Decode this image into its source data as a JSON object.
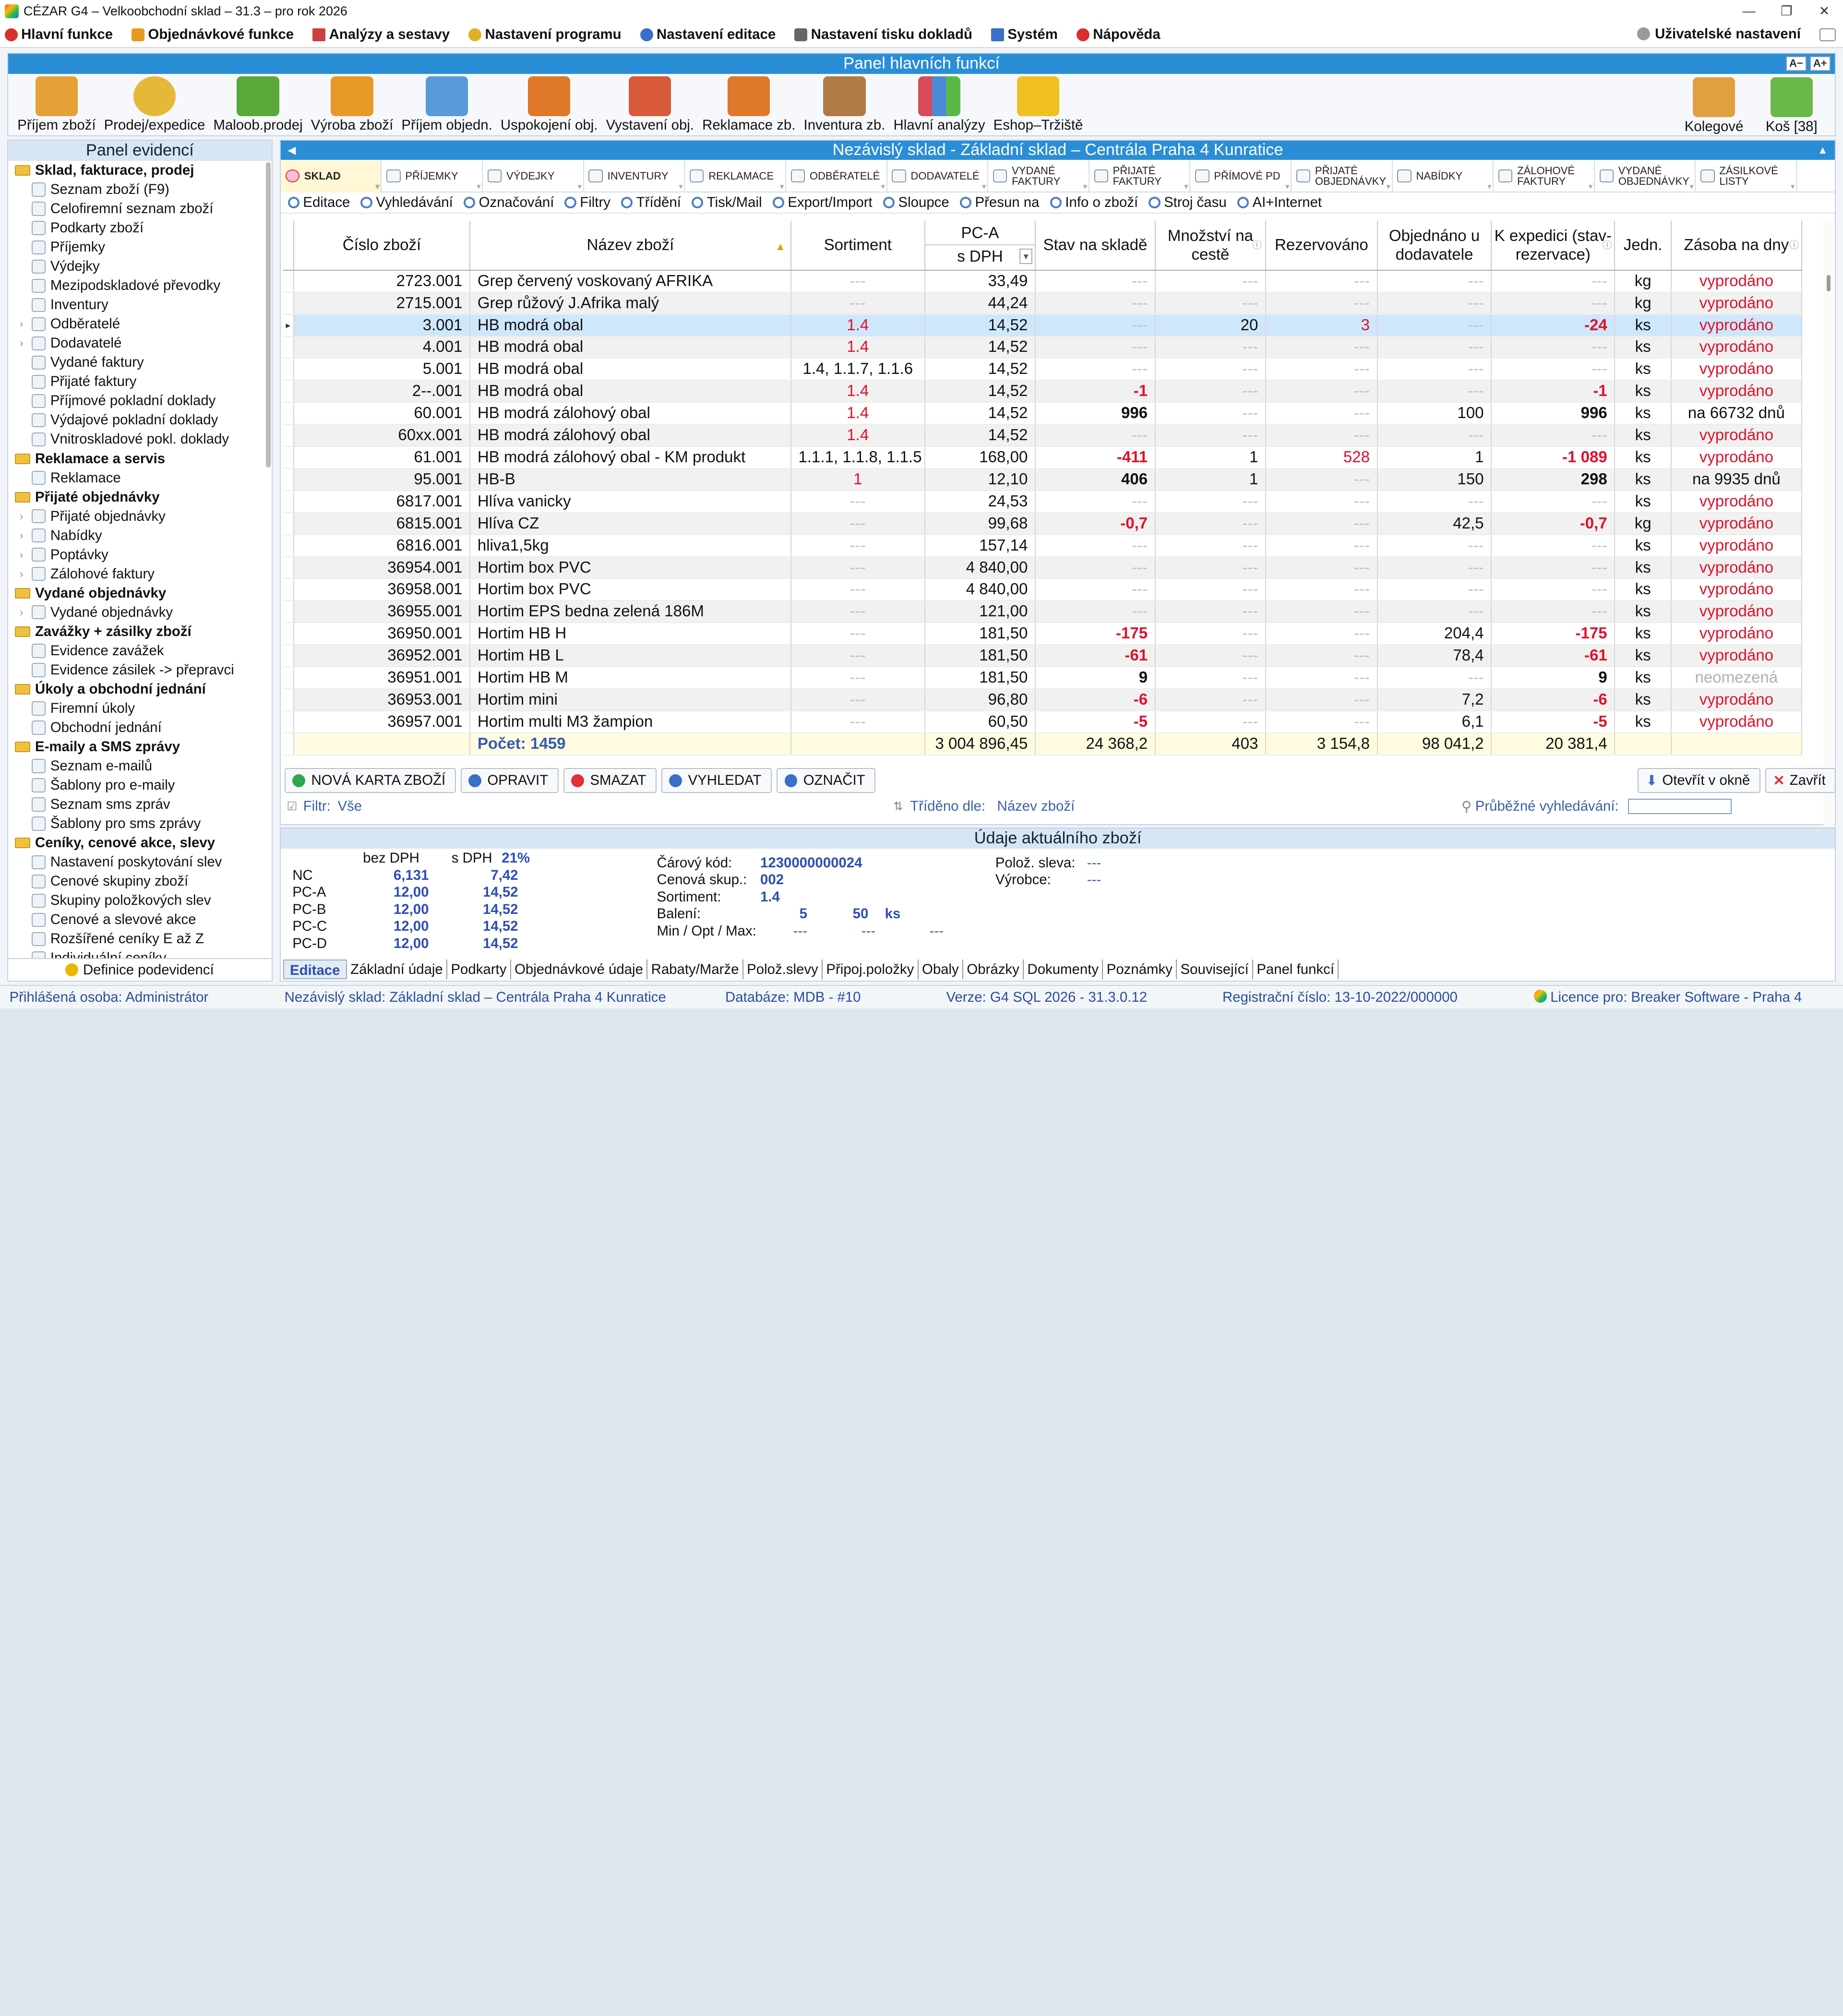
{
  "window": {
    "title": "CÉZAR G4 – Velkoobchodní sklad – 31.3 – pro rok 2026"
  },
  "menu": {
    "items": [
      {
        "label": "Hlavní funkce",
        "color": "#d83030"
      },
      {
        "label": "Objednávkové funkce",
        "color": "#e89a20"
      },
      {
        "label": "Analýzy a sestavy",
        "color": "#cc4040"
      },
      {
        "label": "Nastavení programu",
        "color": "#e0b020"
      },
      {
        "label": "Nastavení editace",
        "color": "#3a6fc8"
      },
      {
        "label": "Nastavení tisku dokladů",
        "color": "#666666"
      },
      {
        "label": "Systém",
        "color": "#3a6fc8"
      },
      {
        "label": "Nápověda",
        "color": "#d83030"
      }
    ],
    "user_settings": "Uživatelské nastavení"
  },
  "main_panel": {
    "title": "Panel hlavních funkcí",
    "zoom_minus": "A−",
    "zoom_plus": "A+",
    "tools": [
      {
        "label": "Příjem zboží",
        "icon": "forklift-icon",
        "color": "#e6a03a"
      },
      {
        "label": "Prodej/expedice",
        "icon": "coins-icon",
        "color": "#e5b838"
      },
      {
        "label": "Maloob.prodej",
        "icon": "basket-icon",
        "color": "#5aa83a"
      },
      {
        "label": "Výroba zboží",
        "icon": "drill-icon",
        "color": "#e69a28"
      },
      {
        "label": "Příjem objedn.",
        "icon": "order-in-icon",
        "color": "#5a9ad8"
      },
      {
        "label": "Uspokojení obj.",
        "icon": "box-icon",
        "color": "#e0782a"
      },
      {
        "label": "Vystavení obj.",
        "icon": "order-out-icon",
        "color": "#d85a3a"
      },
      {
        "label": "Reklamace zb.",
        "icon": "warning-box-icon",
        "color": "#e0782a"
      },
      {
        "label": "Inventura zb.",
        "icon": "clipboard-icon",
        "color": "#b07a45"
      },
      {
        "label": "Hlavní analýzy",
        "icon": "bar-chart-icon",
        "color": "#d84a5a"
      },
      {
        "label": "Eshop–Tržiště",
        "icon": "eshop-icon",
        "color": "#f0c020"
      }
    ],
    "right_tools": [
      {
        "label": "Kolegové",
        "icon": "folder-icon",
        "color": "#e0a040"
      },
      {
        "label": "Koš [38]",
        "icon": "recycle-bin-icon",
        "color": "#6ab84a"
      }
    ]
  },
  "left_panel": {
    "title": "Panel evidencí",
    "groups": [
      {
        "label": "Sklad, fakturace, prodej",
        "items": [
          "Seznam zboží (F9)",
          "Celofiremní seznam zboží",
          "Podkarty zboží",
          "Příjemky",
          "Výdejky",
          "Mezipodskladové převodky",
          "Inventury",
          "Odběratelé",
          "Dodavatelé",
          "Vydané faktury",
          "Přijaté faktury",
          "Příjmové pokladní doklady",
          "Výdajové pokladní doklady",
          "Vnitroskladové pokl. doklady"
        ]
      },
      {
        "label": "Reklamace a servis",
        "items": [
          "Reklamace"
        ]
      },
      {
        "label": "Přijaté objednávky",
        "items": [
          "Přijaté objednávky",
          "Nabídky",
          "Poptávky",
          "Zálohové faktury"
        ]
      },
      {
        "label": "Vydané objednávky",
        "items": [
          "Vydané objednávky"
        ]
      },
      {
        "label": "Zavážky + zásilky zboží",
        "items": [
          "Evidence zavážek",
          "Evidence zásilek -> přepravci"
        ]
      },
      {
        "label": "Úkoly a obchodní jednání",
        "items": [
          "Firemní úkoly",
          "Obchodní jednání"
        ]
      },
      {
        "label": "E-maily a SMS zprávy",
        "items": [
          "Seznam e-mailů",
          "Šablony pro e-maily",
          "Seznam sms zpráv",
          "Šablony pro sms zprávy"
        ]
      },
      {
        "label": "Ceníky, cenové akce, slevy",
        "items": [
          "Nastavení poskytování slev",
          "Cenové skupiny zboží",
          "Skupiny položkových slev",
          "Cenové a slevové akce",
          "Rozšířené ceníky E až Z",
          "Individuální ceníky"
        ]
      }
    ],
    "footer": "Definice podevidencí"
  },
  "content": {
    "title": "Nezávislý sklad - Základní sklad – Centrála Praha 4 Kunratice",
    "tabs": [
      "Sklad",
      "Příjemky",
      "Výdejky",
      "Inventury",
      "Reklamace",
      "Odběratelé",
      "Dodavatelé",
      "Vydané faktury",
      "Přijaté faktury",
      "Přímové PD",
      "Přijaté objednávky",
      "Nabídky",
      "Zálohové faktury",
      "Vydané objednávky",
      "Zásilkové listy"
    ],
    "toolbar": [
      "Editace",
      "Vyhledávání",
      "Označování",
      "Filtry",
      "Třídění",
      "Tisk/Mail",
      "Export/Import",
      "Sloupce",
      "Přesun na",
      "Info o zboží",
      "Stroj času",
      "AI+Internet"
    ],
    "columns": {
      "code": "Číslo zboží",
      "name": "Název zboží",
      "sort": "Sortiment",
      "price_top": "PC-A",
      "price_bottom": "s DPH",
      "stock": "Stav na skladě",
      "transit": "Množství na cestě",
      "reserved": "Rezervováno",
      "ordered": "Objednáno u dodavatele",
      "dispatch": "K expedici (stav-rezervace)",
      "unit": "Jedn.",
      "supply": "Zásoba na dny"
    },
    "rows": [
      {
        "code": "2723.001",
        "name": "Grep červený voskovaný AFRIKA",
        "sort": "---",
        "price": "33,49",
        "stock": "---",
        "transit": "---",
        "reserved": "---",
        "ordered": "---",
        "dispatch": "---",
        "unit": "kg",
        "supply": "vyprodáno"
      },
      {
        "code": "2715.001",
        "name": "Grep růžový J.Afrika malý",
        "sort": "---",
        "price": "44,24",
        "stock": "---",
        "transit": "---",
        "reserved": "---",
        "ordered": "---",
        "dispatch": "---",
        "unit": "kg",
        "supply": "vyprodáno"
      },
      {
        "code": "3.001",
        "name": "HB modrá obal",
        "sort": "1.4",
        "price": "14,52",
        "stock": "---",
        "transit": "20",
        "reserved": "3",
        "ordered": "---",
        "dispatch": "-24",
        "unit": "ks",
        "supply": "vyprodáno"
      },
      {
        "code": "4.001",
        "name": "HB modrá obal",
        "sort": "1.4",
        "price": "14,52",
        "stock": "---",
        "transit": "---",
        "reserved": "---",
        "ordered": "---",
        "dispatch": "---",
        "unit": "ks",
        "supply": "vyprodáno"
      },
      {
        "code": "5.001",
        "name": "HB modrá obal",
        "sort": "1.4, 1.1.7, 1.1.6",
        "price": "14,52",
        "stock": "---",
        "transit": "---",
        "reserved": "---",
        "ordered": "---",
        "dispatch": "---",
        "unit": "ks",
        "supply": "vyprodáno"
      },
      {
        "code": "2--.001",
        "name": "HB modrá obal",
        "sort": "1.4",
        "price": "14,52",
        "stock": "-1",
        "transit": "---",
        "reserved": "---",
        "ordered": "---",
        "dispatch": "-1",
        "unit": "ks",
        "supply": "vyprodáno"
      },
      {
        "code": "60.001",
        "name": "HB modrá zálohový obal",
        "sort": "1.4",
        "price": "14,52",
        "stock": "996",
        "transit": "---",
        "reserved": "---",
        "ordered": "100",
        "dispatch": "996",
        "unit": "ks",
        "supply": "na 66732 dnů"
      },
      {
        "code": "60xx.001",
        "name": "HB modrá zálohový obal",
        "sort": "1.4",
        "price": "14,52",
        "stock": "---",
        "transit": "---",
        "reserved": "---",
        "ordered": "---",
        "dispatch": "---",
        "unit": "ks",
        "supply": "vyprodáno"
      },
      {
        "code": "61.001",
        "name": "HB modrá zálohový obal - KM produkt",
        "sort": "1.1.1, 1.1.8, 1.1.5",
        "price": "168,00",
        "stock": "-411",
        "transit": "1",
        "reserved": "528",
        "ordered": "1",
        "dispatch": "-1 089",
        "unit": "ks",
        "supply": "vyprodáno"
      },
      {
        "code": "95.001",
        "name": "HB-B",
        "sort": "1",
        "price": "12,10",
        "stock": "406",
        "transit": "1",
        "reserved": "---",
        "ordered": "150",
        "dispatch": "298",
        "unit": "ks",
        "supply": "na 9935 dnů"
      },
      {
        "code": "6817.001",
        "name": "Hlíva  vanicky",
        "sort": "---",
        "price": "24,53",
        "stock": "---",
        "transit": "---",
        "reserved": "---",
        "ordered": "---",
        "dispatch": "---",
        "unit": "ks",
        "supply": "vyprodáno"
      },
      {
        "code": "6815.001",
        "name": "Hlíva CZ",
        "sort": "---",
        "price": "99,68",
        "stock": "-0,7",
        "transit": "---",
        "reserved": "---",
        "ordered": "42,5",
        "dispatch": "-0,7",
        "unit": "kg",
        "supply": "vyprodáno"
      },
      {
        "code": "6816.001",
        "name": "hliva1,5kg",
        "sort": "---",
        "price": "157,14",
        "stock": "---",
        "transit": "---",
        "reserved": "---",
        "ordered": "---",
        "dispatch": "---",
        "unit": "ks",
        "supply": "vyprodáno"
      },
      {
        "code": "36954.001",
        "name": "Hortim box PVC",
        "sort": "---",
        "price": "4 840,00",
        "stock": "---",
        "transit": "---",
        "reserved": "---",
        "ordered": "---",
        "dispatch": "---",
        "unit": "ks",
        "supply": "vyprodáno"
      },
      {
        "code": "36958.001",
        "name": "Hortim box PVC",
        "sort": "---",
        "price": "4 840,00",
        "stock": "---",
        "transit": "---",
        "reserved": "---",
        "ordered": "---",
        "dispatch": "---",
        "unit": "ks",
        "supply": "vyprodáno"
      },
      {
        "code": "36955.001",
        "name": "Hortim EPS bedna zelená 186M",
        "sort": "---",
        "price": "121,00",
        "stock": "---",
        "transit": "---",
        "reserved": "---",
        "ordered": "---",
        "dispatch": "---",
        "unit": "ks",
        "supply": "vyprodáno"
      },
      {
        "code": "36950.001",
        "name": "Hortim HB H",
        "sort": "---",
        "price": "181,50",
        "stock": "-175",
        "transit": "---",
        "reserved": "---",
        "ordered": "204,4",
        "dispatch": "-175",
        "unit": "ks",
        "supply": "vyprodáno"
      },
      {
        "code": "36952.001",
        "name": "Hortim HB L",
        "sort": "---",
        "price": "181,50",
        "stock": "-61",
        "transit": "---",
        "reserved": "---",
        "ordered": "78,4",
        "dispatch": "-61",
        "unit": "ks",
        "supply": "vyprodáno"
      },
      {
        "code": "36951.001",
        "name": "Hortim HB M",
        "sort": "---",
        "price": "181,50",
        "stock": "9",
        "transit": "---",
        "reserved": "---",
        "ordered": "---",
        "dispatch": "9",
        "unit": "ks",
        "supply": "neomezená"
      },
      {
        "code": "36953.001",
        "name": "Hortim mini",
        "sort": "---",
        "price": "96,80",
        "stock": "-6",
        "transit": "---",
        "reserved": "---",
        "ordered": "7,2",
        "dispatch": "-6",
        "unit": "ks",
        "supply": "vyprodáno"
      },
      {
        "code": "36957.001",
        "name": "Hortim multi M3 žampion",
        "sort": "---",
        "price": "60,50",
        "stock": "-5",
        "transit": "---",
        "reserved": "---",
        "ordered": "6,1",
        "dispatch": "-5",
        "unit": "ks",
        "supply": "vyprodáno"
      }
    ],
    "summary": {
      "count": "Počet: 1459",
      "price": "3 004 896,45",
      "stock": "24 368,2",
      "transit": "403",
      "reserved": "3 154,8",
      "ordered": "98 041,2",
      "dispatch": "20 381,4"
    },
    "actions": {
      "new": "NOVÁ KARTA ZBOŽÍ",
      "edit": "OPRAVIT",
      "delete": "SMAZAT",
      "search": "VYHLEDAT",
      "mark": "OZNAČIT",
      "open_window": "Otevřít v okně",
      "close": "Zavřít"
    },
    "filter_label": "Filtr:",
    "filter_value": "Vše",
    "sort_label": "Tříděno dle:",
    "sort_value": "Název zboží",
    "running_search": "Průběžné vyhledávání:"
  },
  "details": {
    "title": "Údaje aktuálního zboží",
    "price_headers": {
      "no_vat": "bez DPH",
      "vat": "s DPH",
      "vat_rate": "21%"
    },
    "prices": [
      {
        "label": "NC",
        "no_vat": "6,131",
        "vat": "7,42"
      },
      {
        "label": "PC-A",
        "no_vat": "12,00",
        "vat": "14,52"
      },
      {
        "label": "PC-B",
        "no_vat": "12,00",
        "vat": "14,52"
      },
      {
        "label": "PC-C",
        "no_vat": "12,00",
        "vat": "14,52"
      },
      {
        "label": "PC-D",
        "no_vat": "12,00",
        "vat": "14,52"
      }
    ],
    "barcode_label": "Čárový kód:",
    "barcode": "1230000000024",
    "price_group_label": "Cenová skup.:",
    "price_group": "002",
    "sortiment_label": "Sortiment:",
    "sortiment": "1.4",
    "packing_label": "Balení:",
    "packing_1": "5",
    "packing_2": "50",
    "packing_unit": "ks",
    "minmax_label": "Min / Opt / Max:",
    "min": "---",
    "opt": "---",
    "max": "---",
    "discount_label": "Polož. sleva:",
    "discount": "---",
    "maker_label": "Výrobce:",
    "maker": "---",
    "tabs": [
      "Editace",
      "Základní údaje",
      "Podkarty",
      "Objednávkové údaje",
      "Rabaty/Marže",
      "Polož.slevy",
      "Připoj.položky",
      "Obaly",
      "Obrázky",
      "Dokumenty",
      "Poznámky",
      "Související",
      "Panel funkcí"
    ]
  },
  "status": {
    "user_label": "Přihlášená osoba:",
    "user": "Administrátor",
    "store_label": "Nezávislý sklad:",
    "store": "Základní sklad – Centrála Praha 4 Kunratice",
    "db_label": "Databáze:",
    "db": "MDB - #10",
    "version_label": "Verze:",
    "version": "G4 SQL 2026 - 31.3.0.12",
    "reg_label": "Registrační číslo:",
    "reg": "13-10-2022/000000",
    "license_label": "Licence pro:",
    "license": "Breaker Software - Praha 4"
  }
}
